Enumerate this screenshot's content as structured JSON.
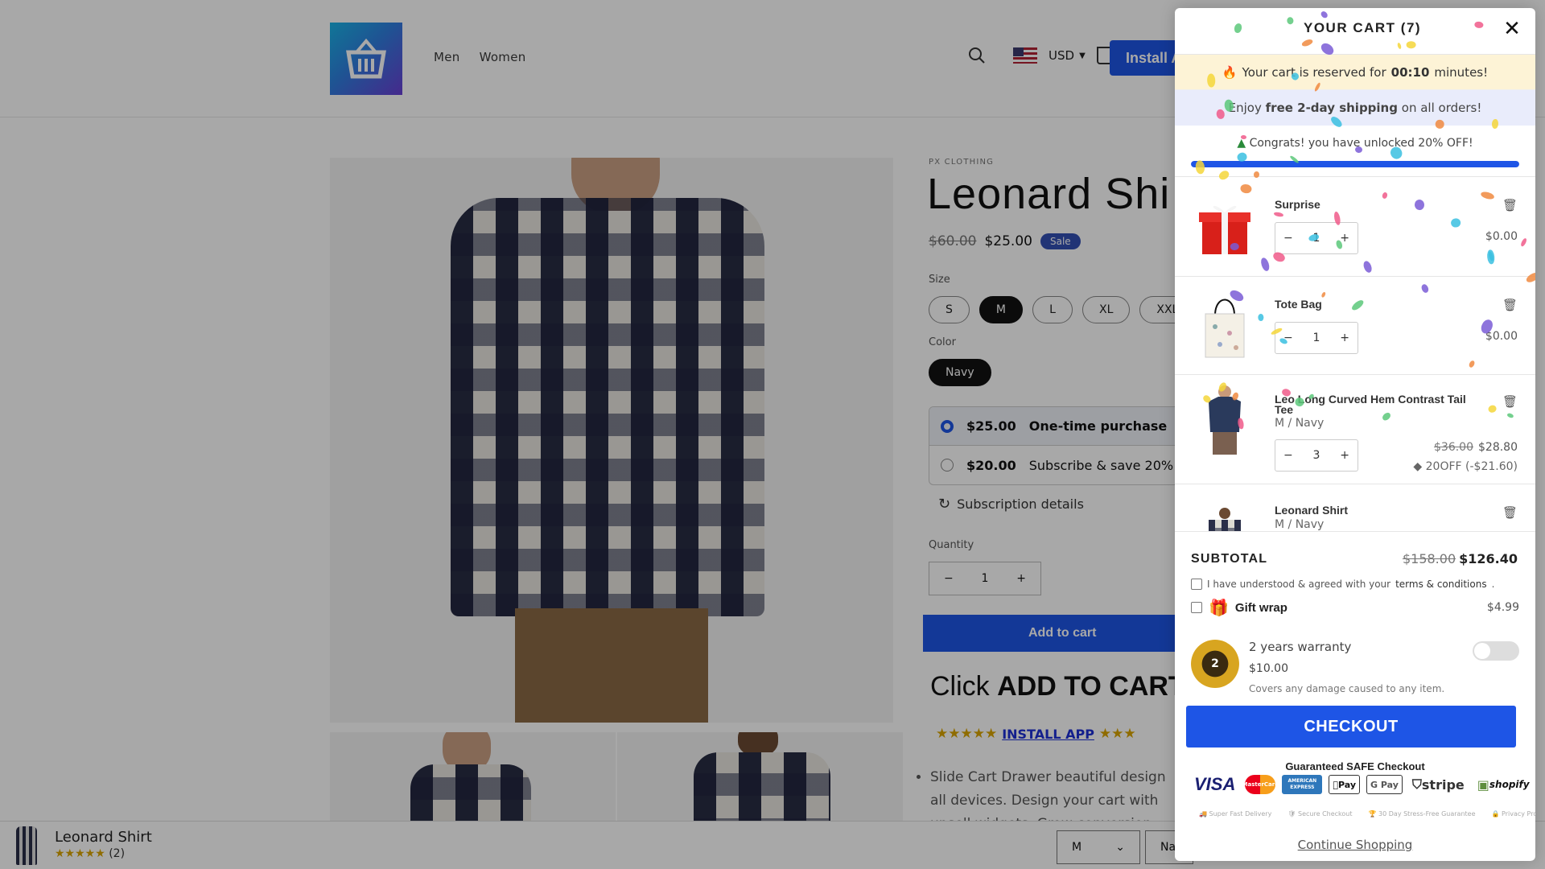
{
  "header": {
    "nav": [
      "Men",
      "Women"
    ],
    "currency": "USD",
    "cart_count": "7",
    "install_label": "Install A"
  },
  "product": {
    "vendor": "PX CLOTHING",
    "title": "Leonard Shi",
    "price_old": "$60.00",
    "price_new": "$25.00",
    "sale_badge": "Sale",
    "size_label": "Size",
    "sizes": [
      "S",
      "M",
      "L",
      "XL",
      "XXL"
    ],
    "selected_size": "M",
    "color_label": "Color",
    "color": "Navy",
    "plans": [
      {
        "price": "$25.00",
        "label": "One-time purchase"
      },
      {
        "price": "$20.00",
        "label": "Subscribe & save 20%"
      }
    ],
    "subscription_details": "Subscription details",
    "quantity_label": "Quantity",
    "quantity": "1",
    "add_to_cart": "Add to cart",
    "click_prefix": "Click ",
    "click_bold": "ADD TO CART",
    "install_app": "INSTALL APP",
    "desc": "Slide Cart Drawer beautiful design all devices. Design your cart with upsell widgets. Grow conversion"
  },
  "sticky": {
    "name": "Leonard Shirt",
    "stars": "★★★★★",
    "review_count": "(2)",
    "size": "M",
    "color": "Na"
  },
  "cart": {
    "title": "YOUR CART (7)",
    "timer_prefix": "Your cart is reserved for",
    "timer_value": "00:10",
    "timer_suffix": "minutes!",
    "ship_prefix": "Enjoy",
    "ship_bold": "free 2-day shipping",
    "ship_suffix": "on all orders!",
    "congrats": "Congrats! you have unlocked 20% OFF!",
    "progress": 1.0,
    "items": [
      {
        "name": "Surprise",
        "variant": "",
        "qty": "1",
        "price": "$0.00",
        "compare": "",
        "discount": ""
      },
      {
        "name": "Tote Bag",
        "variant": "",
        "qty": "1",
        "price": "$0.00",
        "compare": "",
        "discount": ""
      },
      {
        "name": "Leo Long Curved Hem Contrast Tail Tee",
        "variant": "M / Navy",
        "qty": "3",
        "price": "$28.80",
        "compare": "$36.00",
        "discount": "20OFF (-$21.60)"
      },
      {
        "name": "Leonard Shirt",
        "variant": "M / Navy",
        "qty": "",
        "price": "",
        "compare": "",
        "discount": ""
      }
    ],
    "subtotal_label": "SUBTOTAL",
    "subtotal_old": "$158.00",
    "subtotal_new": "$126.40",
    "terms_text": "I have understood & agreed with your",
    "terms_link": "terms & conditions",
    "terms_end": ".",
    "gift_label": "Gift wrap",
    "gift_price": "$4.99",
    "warranty_badge": "2",
    "warranty_title": "2 years warranty",
    "warranty_price": "$10.00",
    "warranty_desc": "Covers any damage caused to any item.",
    "checkout": "CHECKOUT",
    "safe_checkout": "Guaranteed SAFE Checkout",
    "payments": [
      "VISA",
      "MasterCard",
      "AMERICAN EXPRESS",
      "Pay",
      "G Pay",
      "stripe",
      "shopify"
    ],
    "trust": [
      "Super Fast Delivery",
      "Secure Checkout",
      "30 Day Stress-Free Guarantee",
      "Privacy Protected"
    ],
    "continue": "Continue Shopping"
  },
  "colors": {
    "accent": "#1e55e6",
    "timer_bg": "#fdf3d6",
    "ship_bg": "#e9ecfb"
  }
}
